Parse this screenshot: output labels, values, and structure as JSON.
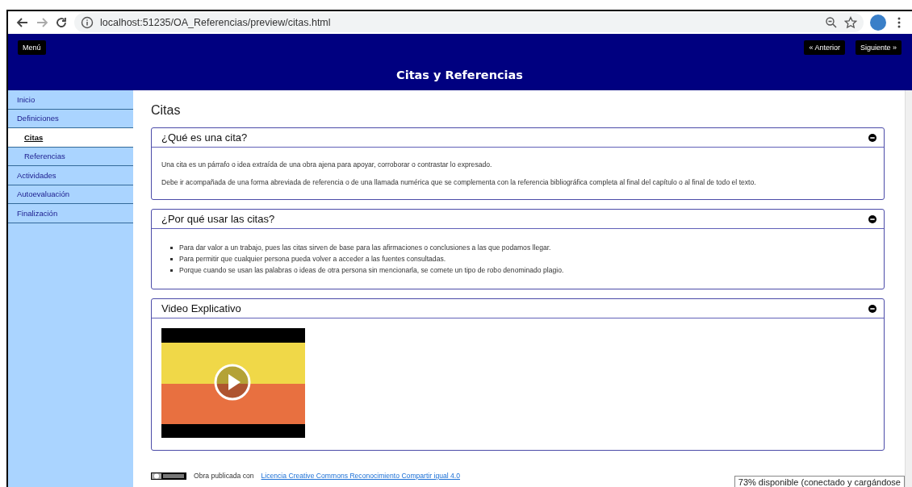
{
  "browser": {
    "url": "localhost:51235/OA_Referencias/preview/citas.html"
  },
  "header": {
    "menu_button": "Menú",
    "prev_button": "« Anterior",
    "next_button": "Siguiente »",
    "title": "Citas y Referencias"
  },
  "sidebar": {
    "items": [
      {
        "label": "Inicio",
        "selected": false
      },
      {
        "label": "Definiciones",
        "selected": false,
        "children": [
          {
            "label": "Citas",
            "selected": true
          },
          {
            "label": "Referencias",
            "selected": false
          }
        ]
      },
      {
        "label": "Actividades",
        "selected": false
      },
      {
        "label": "Autoevaluación",
        "selected": false
      },
      {
        "label": "Finalización",
        "selected": false
      }
    ]
  },
  "content": {
    "title": "Citas",
    "sections": [
      {
        "kind": "paragraphs",
        "title": "¿Qué es una cita?",
        "expanded": true,
        "paragraphs": [
          "Una cita es un párrafo o idea extraída de una obra ajena para apoyar, corroborar o contrastar lo expresado.",
          "Debe ir acompañada de una forma abreviada de referencia o de una llamada numérica que se complementa con la referencia bibliográfica completa al final del capítulo o al final de todo el texto."
        ]
      },
      {
        "kind": "list",
        "title": "¿Por qué usar las citas?",
        "expanded": true,
        "items": [
          "Para dar valor a un trabajo, pues las citas sirven de base para las afirmaciones o conclusiones a las que podamos llegar.",
          "Para permitir que cualquier persona pueda volver a acceder a las fuentes consultadas.",
          "Porque cuando se usan las palabras o ideas de otra persona sin mencionarla, se comete un tipo de robo denominado plagio."
        ]
      },
      {
        "kind": "video",
        "title": "Video Explicativo",
        "expanded": true
      }
    ]
  },
  "footer": {
    "text": "Obra publicada con",
    "link": "Licencia Creative Commons Reconocimiento Compartir igual 4.0"
  },
  "tooltip": "73% disponible (conectado y cargándose"
}
